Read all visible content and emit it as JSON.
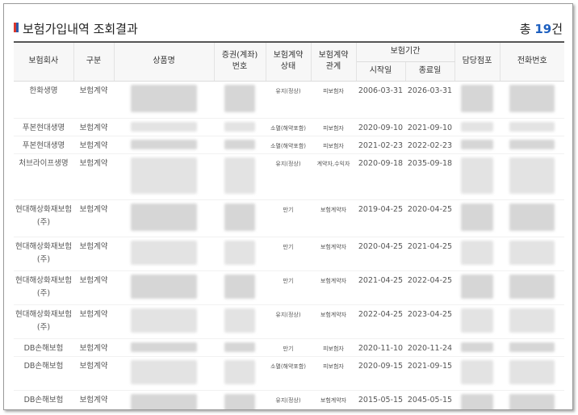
{
  "header": {
    "title": "보험가입내역 조회결과",
    "total_prefix": "총",
    "total_count": "19",
    "total_suffix": "건"
  },
  "columns": {
    "company": "보험회사",
    "kind": "구분",
    "product": "상품명",
    "policy_no_line1": "증권(계좌)",
    "policy_no_line2": "번호",
    "status_line1": "보험계약",
    "status_line2": "상태",
    "relation_line1": "보험계약",
    "relation_line2": "관계",
    "period": "보험기간",
    "start": "시작일",
    "end": "종료일",
    "branch": "담당점포",
    "phone": "전화번호"
  },
  "rows": [
    {
      "company": "한화생명",
      "kind": "보험계약",
      "status": "유지(정상)",
      "relation": "피보험자",
      "start": "2006-03-31",
      "end": "2026-03-31"
    },
    {
      "company": "푸본현대생명",
      "kind": "보험계약",
      "status": "소멸(해약포함)",
      "relation": "피보험자",
      "start": "2020-09-10",
      "end": "2021-09-10"
    },
    {
      "company": "푸본현대생명",
      "kind": "보험계약",
      "status": "소멸(해약포함)",
      "relation": "피보험자",
      "start": "2021-02-23",
      "end": "2022-02-23"
    },
    {
      "company": "처브라이프생명",
      "kind": "보험계약",
      "status": "유지(정상)",
      "relation": "계약자,수익자",
      "start": "2020-09-18",
      "end": "2035-09-18"
    },
    {
      "company": "현대해상화재보험(주)",
      "kind": "보험계약",
      "status": "만기",
      "relation": "보험계약자",
      "start": "2019-04-25",
      "end": "2020-04-25"
    },
    {
      "company": "현대해상화재보험(주)",
      "kind": "보험계약",
      "status": "만기",
      "relation": "보험계약자",
      "start": "2020-04-25",
      "end": "2021-04-25"
    },
    {
      "company": "현대해상화재보험(주)",
      "kind": "보험계약",
      "status": "만기",
      "relation": "보험계약자",
      "start": "2021-04-25",
      "end": "2022-04-25"
    },
    {
      "company": "현대해상화재보험(주)",
      "kind": "보험계약",
      "status": "유지(정상)",
      "relation": "보험계약자",
      "start": "2022-04-25",
      "end": "2023-04-25"
    },
    {
      "company": "DB손해보험",
      "kind": "보험계약",
      "status": "만기",
      "relation": "피보험자",
      "start": "2020-11-10",
      "end": "2020-11-24"
    },
    {
      "company": "DB손해보험",
      "kind": "보험계약",
      "status": "소멸(해약포함)",
      "relation": "피보험자",
      "start": "2020-09-15",
      "end": "2021-09-15"
    },
    {
      "company": "DB손해보험",
      "kind": "보험계약",
      "status": "유지(정상)",
      "relation": "보험계약자",
      "start": "2015-05-15",
      "end": "2045-05-15"
    }
  ]
}
